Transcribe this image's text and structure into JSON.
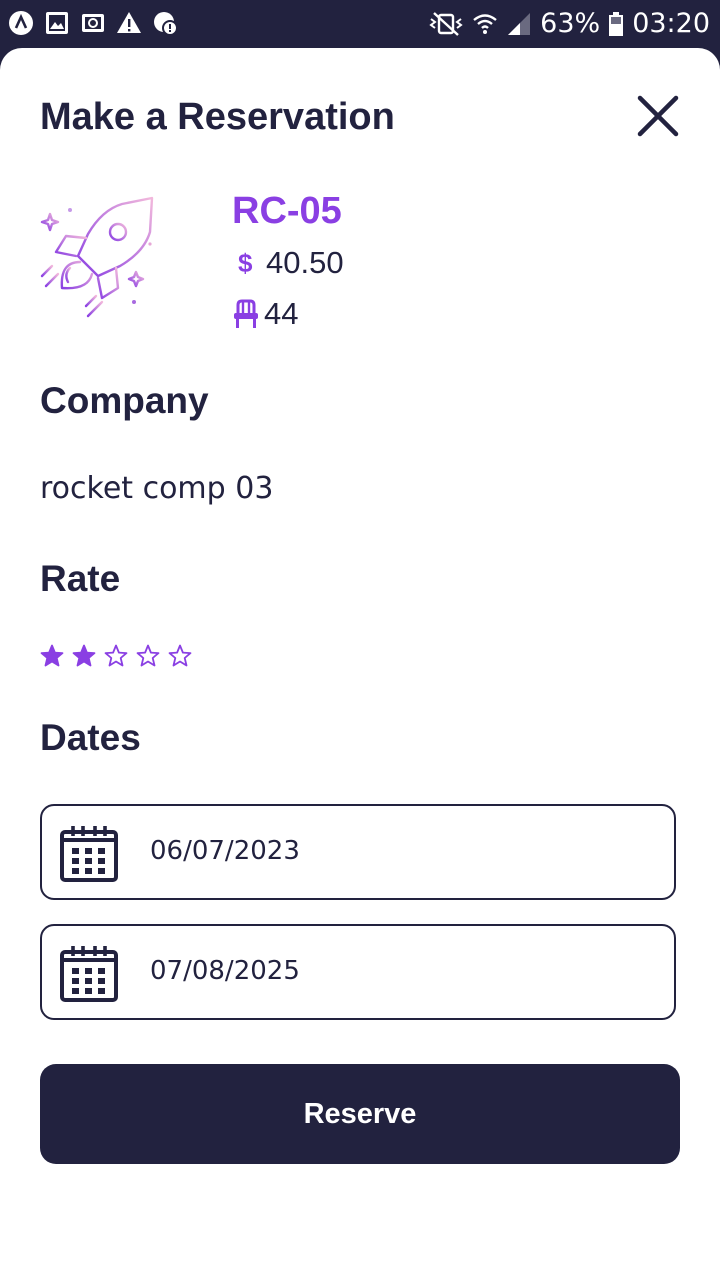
{
  "status_bar": {
    "battery": "63%",
    "time": "03:20",
    "icons_left": [
      "app-icon",
      "image-icon",
      "cast-icon",
      "warning-icon",
      "data-saver-icon"
    ],
    "icons_right": [
      "vibrate-mute-icon",
      "wifi-icon",
      "signal-icon",
      "battery-icon"
    ]
  },
  "modal": {
    "title": "Make a Reservation",
    "close_icon": "close-icon"
  },
  "rocket": {
    "code": "RC-05",
    "currency_symbol": "$",
    "price": "40.50",
    "seats": "44",
    "image_icon": "rocket-icon",
    "seat_icon": "seat-icon"
  },
  "company": {
    "heading": "Company",
    "value": "rocket comp 03"
  },
  "rate": {
    "heading": "Rate",
    "value": 2,
    "max": 5
  },
  "dates": {
    "heading": "Dates",
    "start": "06/07/2023",
    "end": "07/08/2025",
    "icon": "calendar-icon"
  },
  "reserve_button": {
    "label": "Reserve"
  },
  "colors": {
    "primary": "#22223f",
    "accent": "#8a3fe3",
    "background": "#ffffff"
  }
}
